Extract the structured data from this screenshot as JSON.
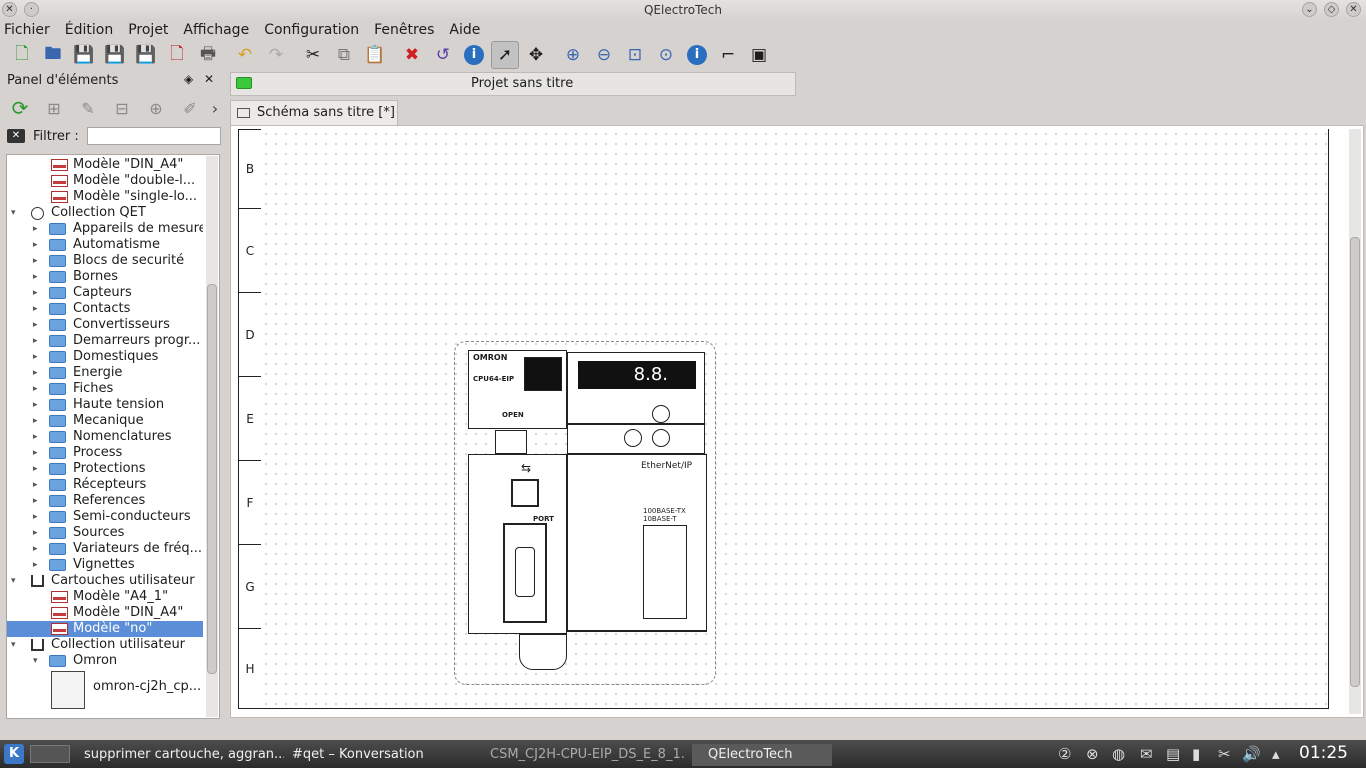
{
  "window": {
    "title": "QElectroTech"
  },
  "menu": [
    "Fichier",
    "Édition",
    "Projet",
    "Affichage",
    "Configuration",
    "Fenêtres",
    "Aide"
  ],
  "panel": {
    "title": "Panel d'éléments",
    "filter_label": "Filtrer :",
    "filter_value": "",
    "tree": [
      {
        "label": "Modèle \"DIN_A4\"",
        "kind": "tmpl",
        "level": 2
      },
      {
        "label": "Modèle \"double-l...",
        "kind": "tmpl",
        "level": 2
      },
      {
        "label": "Modèle \"single-lo...",
        "kind": "tmpl",
        "level": 2
      },
      {
        "label": "Collection QET",
        "kind": "qet",
        "level": 1,
        "expanded": true
      },
      {
        "label": "Appareils de mesure",
        "kind": "folder",
        "level": 2
      },
      {
        "label": "Automatisme",
        "kind": "folder",
        "level": 2
      },
      {
        "label": "Blocs de securité",
        "kind": "folder",
        "level": 2
      },
      {
        "label": "Bornes",
        "kind": "folder",
        "level": 2
      },
      {
        "label": "Capteurs",
        "kind": "folder",
        "level": 2
      },
      {
        "label": "Contacts",
        "kind": "folder",
        "level": 2
      },
      {
        "label": "Convertisseurs",
        "kind": "folder",
        "level": 2
      },
      {
        "label": "Demarreurs progr...",
        "kind": "folder",
        "level": 2
      },
      {
        "label": "Domestiques",
        "kind": "folder",
        "level": 2
      },
      {
        "label": "Energie",
        "kind": "folder",
        "level": 2
      },
      {
        "label": "Fiches",
        "kind": "folder",
        "level": 2
      },
      {
        "label": "Haute tension",
        "kind": "folder",
        "level": 2
      },
      {
        "label": "Mecanique",
        "kind": "folder",
        "level": 2
      },
      {
        "label": "Nomenclatures",
        "kind": "folder",
        "level": 2
      },
      {
        "label": "Process",
        "kind": "folder",
        "level": 2
      },
      {
        "label": "Protections",
        "kind": "folder",
        "level": 2
      },
      {
        "label": "Récepteurs",
        "kind": "folder",
        "level": 2
      },
      {
        "label": "References",
        "kind": "folder",
        "level": 2
      },
      {
        "label": "Semi-conducteurs",
        "kind": "folder",
        "level": 2
      },
      {
        "label": "Sources",
        "kind": "folder",
        "level": 2
      },
      {
        "label": "Variateurs de fréq...",
        "kind": "folder",
        "level": 2
      },
      {
        "label": "Vignettes",
        "kind": "folder",
        "level": 2
      },
      {
        "label": "Cartouches utilisateur",
        "kind": "home",
        "level": 1,
        "expanded": true
      },
      {
        "label": "Modèle \"A4_1\"",
        "kind": "tmpl",
        "level": 2
      },
      {
        "label": "Modèle \"DIN_A4\"",
        "kind": "tmpl",
        "level": 2
      },
      {
        "label": "Modèle \"no\"",
        "kind": "tmpl",
        "level": 2,
        "selected": true
      },
      {
        "label": "Collection utilisateur",
        "kind": "home",
        "level": 1,
        "expanded": true
      },
      {
        "label": "Omron",
        "kind": "folder",
        "level": 2,
        "expanded": true
      },
      {
        "label": "omron-cj2h_cp...",
        "kind": "element",
        "level": 3
      }
    ]
  },
  "project_tab": {
    "label": "Projet sans titre"
  },
  "doc_tab": {
    "label": "Schéma sans titre [*]"
  },
  "ruler_rows": [
    "B",
    "C",
    "D",
    "E",
    "F",
    "G",
    "H"
  ],
  "plc": {
    "brand": "OMRON",
    "model": "CPU64-EIP",
    "display": "8.8.",
    "open": "OPEN",
    "ethernet": "EtherNet/IP",
    "port": "PORT",
    "base1": "100BASE-TX",
    "base2": "10BASE-T"
  },
  "taskbar": {
    "tasks": [
      "supprimer cartouche, aggran...",
      "#qet – Konversation",
      "CSM_CJ2H-CPU-EIP_DS_E_8_1...",
      "QElectroTech"
    ],
    "clock": "01:25"
  }
}
